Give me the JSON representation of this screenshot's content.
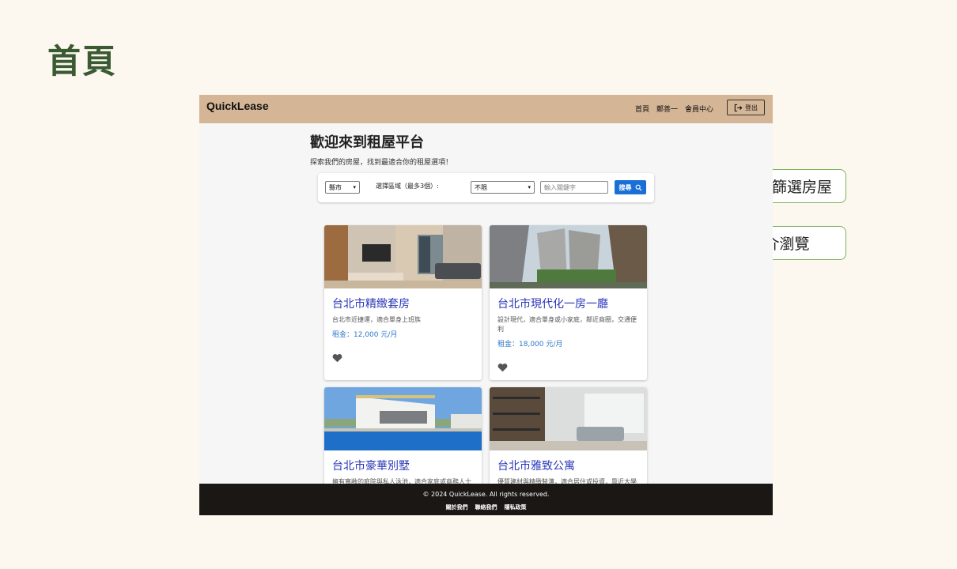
{
  "slide": {
    "title": "首頁",
    "callouts": [
      "運用縣市區域篩選房屋",
      "縮圖、簡介瀏覽"
    ]
  },
  "nav": {
    "brand": "QuickLease",
    "links": [
      "首頁",
      "鄭善一",
      "會員中心"
    ],
    "logout_label": "登出"
  },
  "hero": {
    "title": "歡迎來到租屋平台",
    "subtitle": "探索我們的房屋，找到最適合你的租屋選項！"
  },
  "filter": {
    "city_value": "縣市",
    "region_label": "選擇區域（最多3個）:",
    "district_value": "不限",
    "keyword_placeholder": "輸入關鍵字",
    "search_label": "搜尋"
  },
  "listings": [
    {
      "title": "台北市精緻套房",
      "desc": "台北市近捷運，適合單身上班族",
      "price": "租金：12,000 元/月"
    },
    {
      "title": "台北市現代化一房一廳",
      "desc": "設計現代，適合單身或小家庭，鄰近商圈，交通便利",
      "price": "租金：18,000 元/月"
    },
    {
      "title": "台北市豪華別墅",
      "desc": "擁有寬敞的庭院與私人泳池，適合家庭或商務人士",
      "price": ""
    },
    {
      "title": "台北市雅致公寓",
      "desc": "優質建材與精緻裝潢，適合居住或投資，靠近大學",
      "price": ""
    }
  ],
  "footer": {
    "copyright": "© 2024 QuickLease. All rights reserved.",
    "links": [
      "關於我們",
      "聯絡我們",
      "隱私政策"
    ]
  },
  "colors": {
    "nav_bg": "#d4b596",
    "accent": "#1a6fd6",
    "title_link": "#2a37b8",
    "callout_border": "#7cb25a"
  },
  "icons": [
    "logout-icon",
    "search-icon",
    "heart-icon",
    "chevron-down-icon"
  ]
}
